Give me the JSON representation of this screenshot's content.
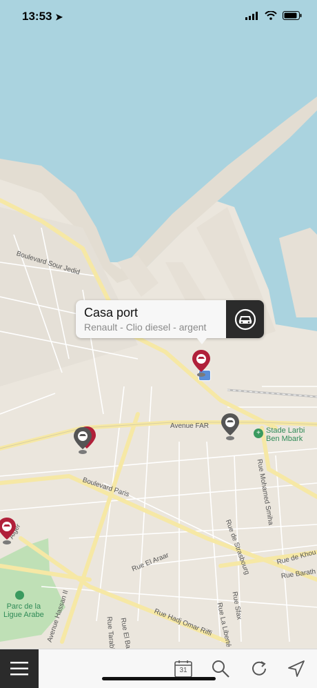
{
  "status": {
    "time": "13:53"
  },
  "map": {
    "roads": {
      "boulevard_sour_jedid": "Boulevard Sour Jedid",
      "avenue_far": "Avenue FAR",
      "boulevard_paris": "Boulevard Paris",
      "rue_mohamed_smiha": "Rue Mohamed Smiha",
      "rue_de_strasbourg": "Rue de Strasbourg",
      "rue_el_araar": "Rue El Araar",
      "rue_hadj_omar_riffi": "Rue Hadj Omar Riffi",
      "avenue_hassan_ii": "Avenue Hassan II",
      "rue_de_khou": "Rue de Khou",
      "rue_barath": "Rue Barath",
      "rue_sfax": "Rue Sfax",
      "rue_la_liberte": "Rue La Liberté",
      "rue_el_bann": "Rue El Ban",
      "rue_tarablous": "Rue Tarabl",
      "alger": "Alger"
    },
    "places": {
      "stade_line1": "Stade Larbi",
      "stade_line2": "Ben Mbark",
      "parc_line1": "Parc de la",
      "parc_line2": "Ligue Arabe"
    }
  },
  "callout": {
    "title": "Casa port",
    "subtitle": "Renault - Clio diesel - argent",
    "action_icon": "car-icon"
  },
  "toolbar": {
    "menu_icon": "hamburger-menu-icon",
    "calendar_day": "31",
    "search_icon": "search-icon",
    "refresh_icon": "refresh-icon",
    "locate_icon": "location-arrow-icon"
  },
  "colors": {
    "water": "#aad3df",
    "land": "#e9e4dc",
    "pin_red": "#b0203a",
    "pin_gray": "#555555",
    "dark_button": "#2b2b2b"
  }
}
